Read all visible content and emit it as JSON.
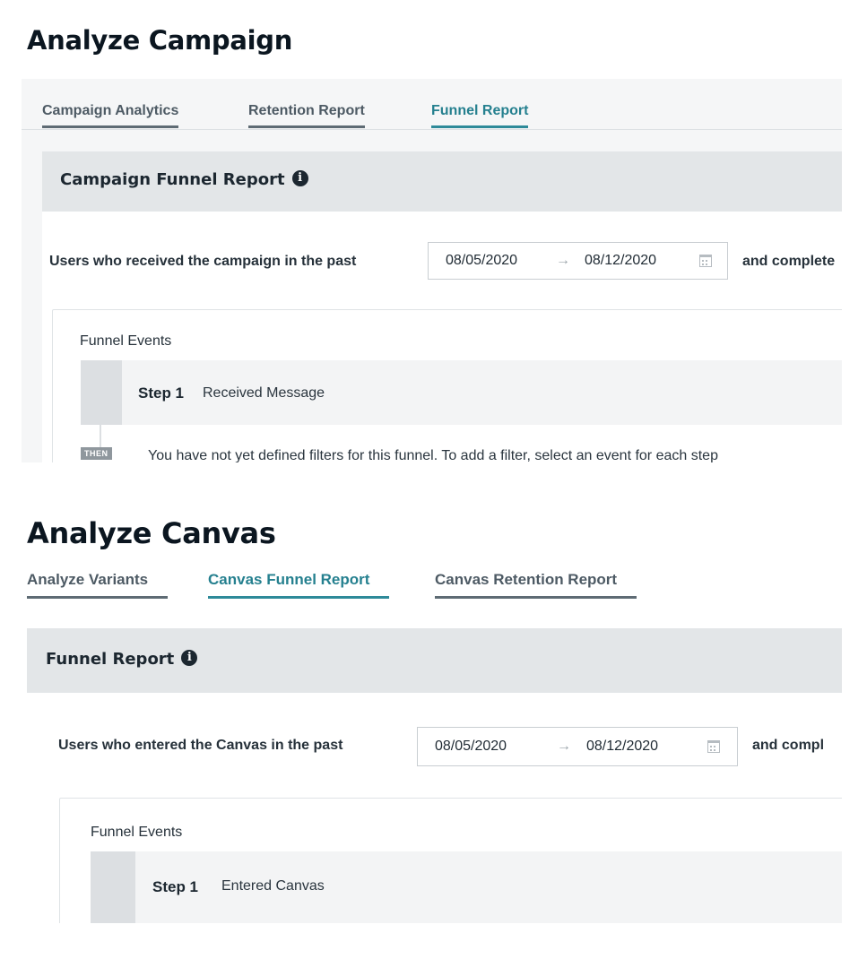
{
  "campaign": {
    "title": "Analyze Campaign",
    "tabs": [
      {
        "label": "Campaign Analytics",
        "active": false
      },
      {
        "label": "Retention Report",
        "active": false
      },
      {
        "label": "Funnel Report",
        "active": true
      }
    ],
    "panel_title": "Campaign Funnel Report",
    "filter_label": "Users who received the campaign in the past",
    "date_start": "08/05/2020",
    "date_arrow": "→",
    "date_end": "08/12/2020",
    "trailing_text": "and complete",
    "funnel_events_label": "Funnel Events",
    "step_label": "Step 1",
    "step_event": "Received Message",
    "then_badge": "THEN",
    "then_text": "You have not yet defined filters for this funnel. To add a filter, select an event for each step"
  },
  "canvas": {
    "title": "Analyze Canvas",
    "tabs": [
      {
        "label": "Analyze Variants",
        "active": false
      },
      {
        "label": "Canvas Funnel Report",
        "active": true
      },
      {
        "label": "Canvas Retention Report",
        "active": false
      }
    ],
    "panel_title": "Funnel Report",
    "filter_label": "Users who entered the Canvas in the past",
    "date_start": "08/05/2020",
    "date_arrow": "→",
    "date_end": "08/12/2020",
    "trailing_text": "and compl",
    "funnel_events_label": "Funnel Events",
    "step_label": "Step 1",
    "step_event": "Entered Canvas"
  },
  "icons": {
    "info": "info-circle-icon",
    "calendar": "calendar-icon",
    "arrow": "arrow-right-icon"
  },
  "colors": {
    "active_tab": "#2e8a99",
    "inactive_tab_underline": "#5e6b74",
    "panel_header": "#e3e6e8"
  }
}
